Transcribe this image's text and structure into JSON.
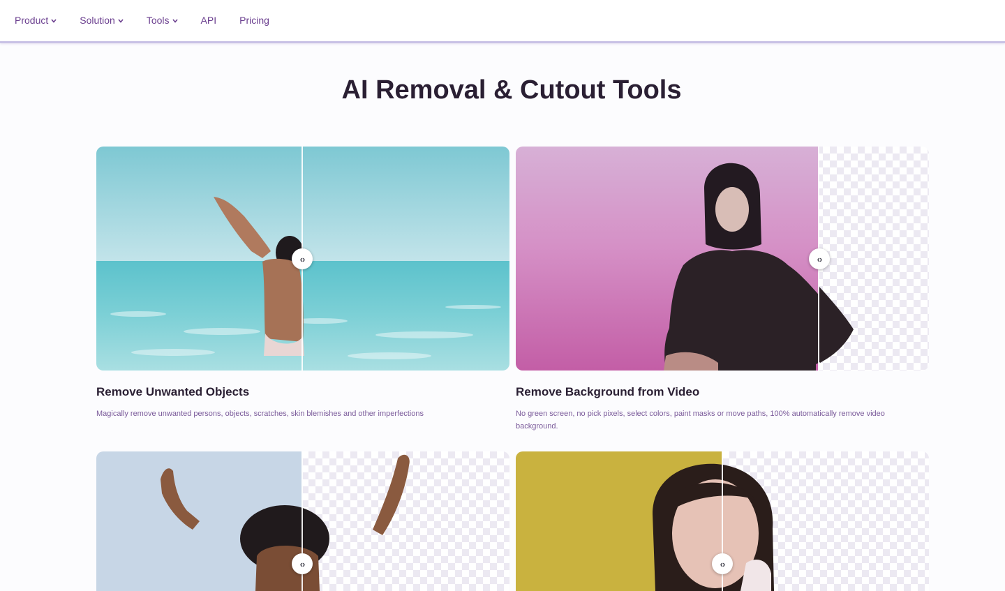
{
  "nav": {
    "items": [
      {
        "label": "Product",
        "dropdown": true
      },
      {
        "label": "Solution",
        "dropdown": true
      },
      {
        "label": "Tools",
        "dropdown": true
      },
      {
        "label": "API",
        "dropdown": false
      },
      {
        "label": "Pricing",
        "dropdown": false
      }
    ]
  },
  "page": {
    "title": "AI Removal & Cutout Tools"
  },
  "cards": [
    {
      "title": "Remove Unwanted Objects",
      "description": "Magically remove unwanted persons, objects, scratches, skin blemishes and other imperfections",
      "handle_icon": "compare-arrows-icon"
    },
    {
      "title": "Remove Background from Video",
      "description": "No green screen, no pick pixels, select colors, paint masks or move paths, 100% automatically remove video background.",
      "handle_icon": "compare-arrows-icon"
    },
    {
      "title": "",
      "description": "",
      "handle_icon": "compare-arrows-icon"
    },
    {
      "title": "",
      "description": "",
      "handle_icon": "compare-arrows-icon"
    }
  ],
  "colors": {
    "nav_text": "#6b3f8f",
    "title_text": "#2a1f33",
    "desc_text": "#7a5a9a",
    "nav_border": "#c9c2e6"
  }
}
